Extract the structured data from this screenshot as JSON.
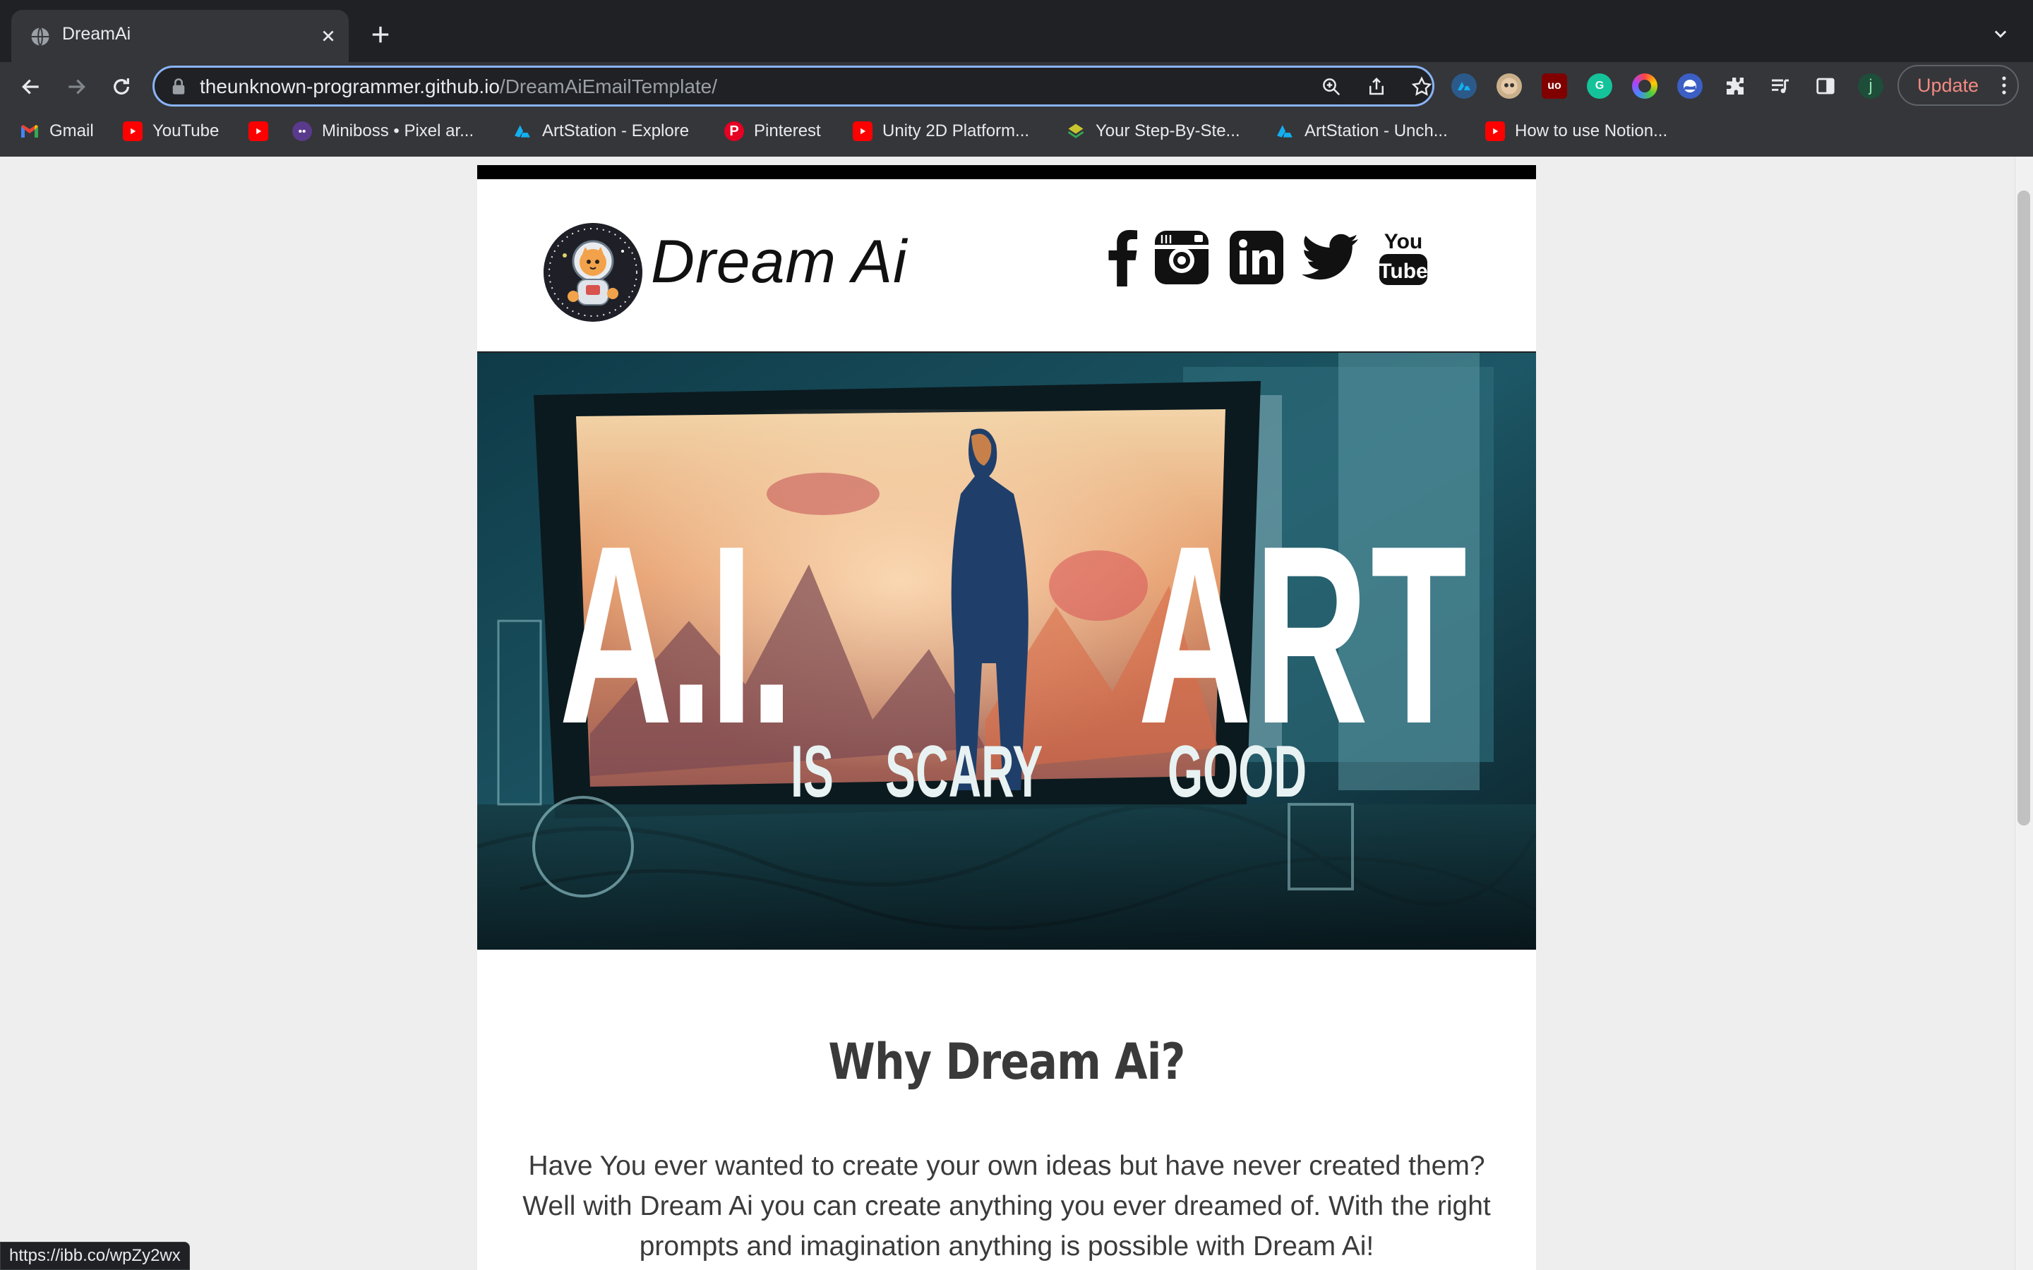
{
  "browser": {
    "tab": {
      "title": "DreamAi"
    },
    "url": {
      "host": "theunknown-programmer.github.io",
      "path": "/DreamAiEmailTemplate/"
    },
    "update_label": "Update",
    "profile_initial": "j",
    "bookmarks": [
      {
        "label": "Gmail",
        "icon": "gmail-icon"
      },
      {
        "label": "YouTube",
        "icon": "youtube-icon"
      },
      {
        "label": "",
        "icon": "youtube-icon"
      },
      {
        "label": "Miniboss • Pixel ar...",
        "icon": "miniboss-icon"
      },
      {
        "label": "ArtStation - Explore",
        "icon": "artstation-icon"
      },
      {
        "label": "Pinterest",
        "icon": "pinterest-icon"
      },
      {
        "label": "Unity 2D Platform...",
        "icon": "youtube-icon"
      },
      {
        "label": "Your Step-By-Ste...",
        "icon": "stepbystep-icon"
      },
      {
        "label": "ArtStation - Unch...",
        "icon": "artstation-icon"
      },
      {
        "label": "How to use Notion...",
        "icon": "youtube-icon"
      }
    ],
    "status_url": "https://ibb.co/wpZy2wx"
  },
  "email": {
    "brand": "Dream Ai",
    "social": [
      "facebook-icon",
      "instagram-icon",
      "linkedin-icon",
      "twitter-icon",
      "youtube-icon"
    ],
    "hero": {
      "headline_left": "A.I.",
      "headline_right": "ART",
      "sub_1": "IS",
      "sub_2": "SCARY",
      "sub_3": "GOOD"
    },
    "section": {
      "title": "Why Dream Ai?",
      "body": "Have You ever wanted to create your own ideas but have never created them? Well with Dream Ai you can create anything you ever dreamed of. With the right prompts and imagination anything is possible with Dream Ai!"
    }
  },
  "colors": {
    "chrome_dark": "#202124",
    "chrome_toolbar": "#35363a",
    "focus_ring": "#8ab4f8",
    "update_text": "#f28b82",
    "page_bg": "#eeeeee",
    "heading": "#3a3a3a"
  }
}
